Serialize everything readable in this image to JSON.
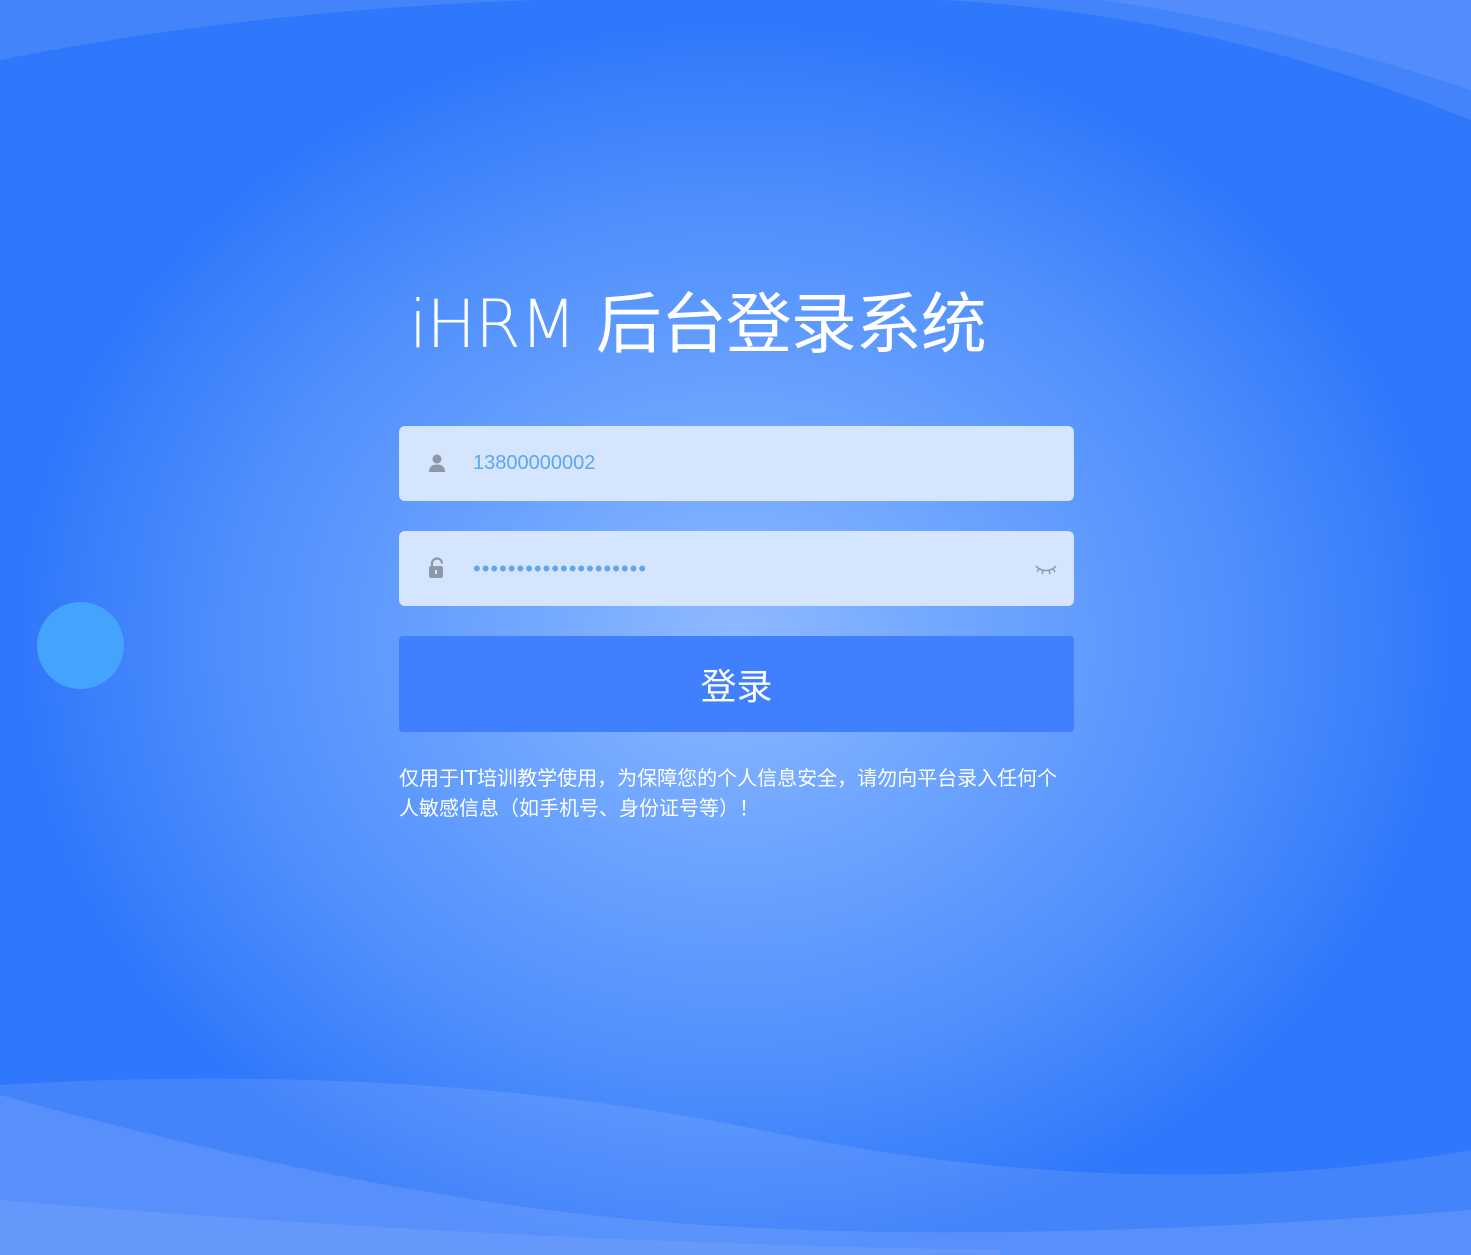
{
  "page": {
    "title": "iHRM 后台登录系统"
  },
  "form": {
    "username": {
      "value": "13800000002",
      "icon": "user-icon"
    },
    "password": {
      "value": "••••••••••••••••••••",
      "icon": "lock-icon",
      "toggle_icon": "eye-closed-icon"
    },
    "submit_label": "登录"
  },
  "notice": "仅用于IT培训教学使用，为保障您的个人信息安全，请勿向平台录入任何个人敏感信息（如手机号、身份证号等）！",
  "colors": {
    "background": "#4f8ffc",
    "button": "#4080fe",
    "input_bg": "#d4e5fd",
    "input_text": "#5fa6ee",
    "deco_circle": "#44a3fd"
  }
}
